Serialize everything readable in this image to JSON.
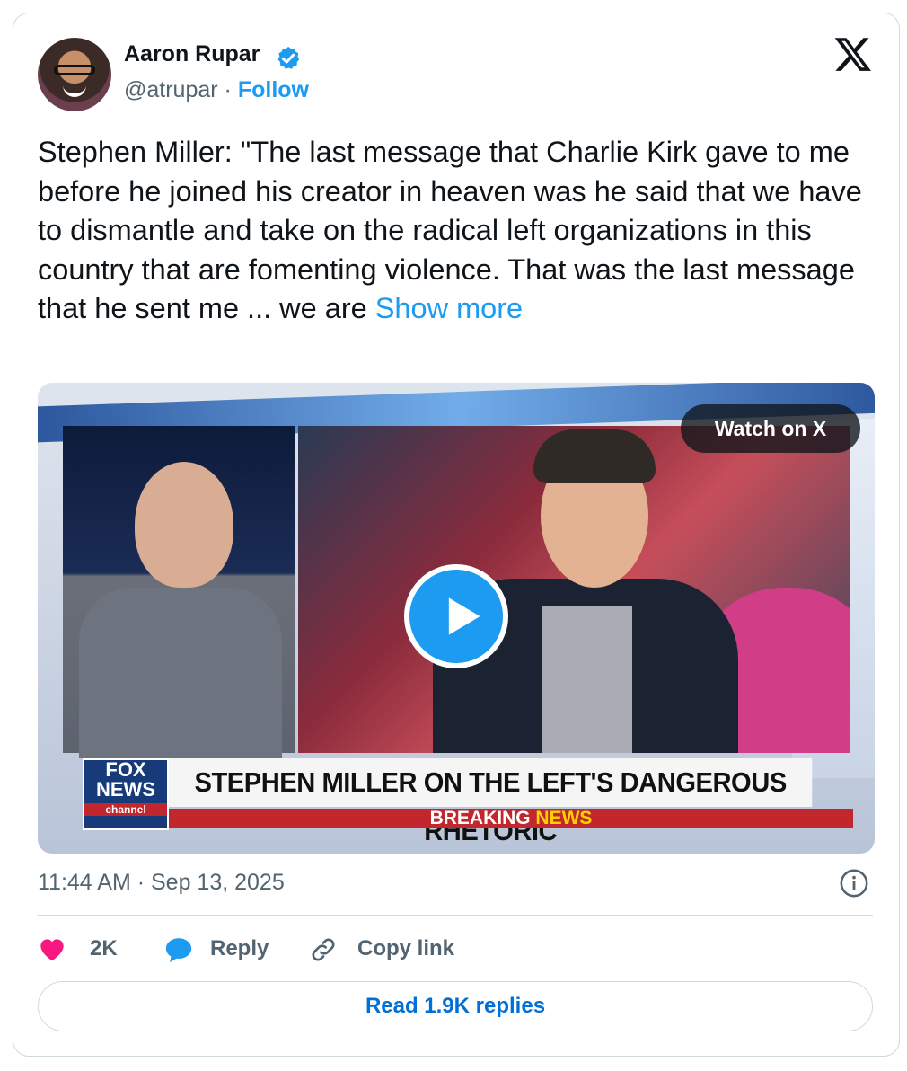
{
  "author": {
    "name": "Aaron Rupar",
    "handle": "@atrupar",
    "separator": "·",
    "follow_label": "Follow"
  },
  "tweet": {
    "text": "Stephen Miller: \"The last message that Charlie Kirk gave to me before he joined his creator in heaven was he said that we have to dismantle and take on the radical left organizations in this country that are fomenting violence. That was the last message that he sent me ... we are ",
    "show_more_label": "Show more"
  },
  "media": {
    "watch_label": "Watch on X",
    "headline": "STEPHEN MILLER ON THE LEFT'S DANGEROUS RHETORIC",
    "breaking_label": "BREAKING",
    "news_label": "NEWS",
    "logo_fox": "FOX",
    "logo_news": "NEWS",
    "logo_channel": "channel"
  },
  "meta": {
    "timestamp": "11:44 AM · Sep 13, 2025"
  },
  "actions": {
    "likes_count": "2K",
    "reply_label": "Reply",
    "copy_link_label": "Copy link"
  },
  "footer": {
    "read_replies_label": "Read 1.9K replies"
  },
  "colors": {
    "accent": "#1d9bf0",
    "like": "#f91880",
    "text_secondary": "#536471"
  }
}
